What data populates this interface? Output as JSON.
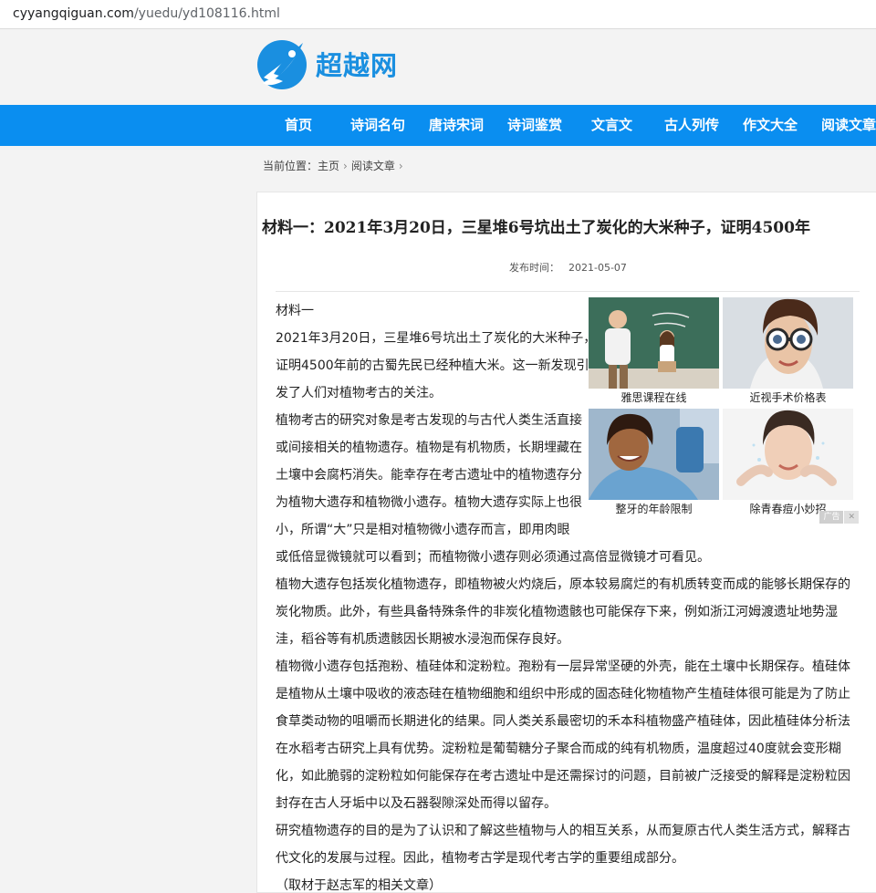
{
  "browser": {
    "url_host": "cyyangqiguan.com",
    "url_path": "/yuedu/yd108116.html"
  },
  "site": {
    "logo_text": "超越网",
    "brand_color": "#1a8fe0",
    "nav_color": "#0a8ef0"
  },
  "nav": {
    "items": [
      "首页",
      "诗词名句",
      "唐诗宋词",
      "诗词鉴赏",
      "文言文",
      "古人列传",
      "作文大全",
      "阅读文章"
    ]
  },
  "breadcrumb": {
    "label": "当前位置：",
    "home": "主页",
    "section": "阅读文章",
    "sep": "›"
  },
  "article": {
    "title": "材料一：2021年3月20日，三星堆6号坑出土了炭化的大米种子，证明4500年",
    "pub_label": "发布时间：",
    "pub_date": "2021-05-07",
    "heading": "材料一",
    "p1_lines": [
      "2021年3月20日，三星堆6号坑出土了炭化的大米种子，",
      "证明4500年前的古蜀先民已经种植大米。这一新发现引",
      "发了人们对植物考古的关注。"
    ],
    "p2_lines": [
      "植物考古的研究对象是考古发现的与古代人类生活直接",
      "或间接相关的植物遗存。植物是有机物质，长期埋藏在",
      "土壤中会腐朽消失。能幸存在考古遗址中的植物遗存分",
      "为植物大遗存和植物微小遗存。植物大遗存实际上也很",
      "小，所谓“大”只是相对植物微小遗存而言，即用肉眼",
      "或低倍显微镜就可以看到；而植物微小遗存则必须通过高倍显微镜才可看见。"
    ],
    "p3_lines": [
      "植物大遗存包括炭化植物遗存，即植物被火灼烧后，原本较易腐烂的有机质转变而成的能够长期保存的",
      "炭化物质。此外，有些具备特殊条件的非炭化植物遗骸也可能保存下来，例如浙江河姆渡遗址地势湿",
      "洼，稻谷等有机质遗骸因长期被水浸泡而保存良好。"
    ],
    "p4_lines": [
      "植物微小遗存包括孢粉、植硅体和淀粉粒。孢粉有一层异常坚硬的外壳，能在土壤中长期保存。植硅体",
      "是植物从土壤中吸收的液态硅在植物细胞和组织中形成的固态硅化物植物产生植硅体很可能是为了防止",
      "食草类动物的咀嚼而长期进化的结果。同人类关系最密切的禾本科植物盛产植硅体，因此植硅体分析法",
      "在水稻考古研究上具有优势。淀粉粒是葡萄糖分子聚合而成的纯有机物质，温度超过40度就会变形糊",
      "化，如此脆弱的淀粉粒如何能保存在考古遗址中是还需探讨的问题，目前被广泛接受的解释是淀粉粒因",
      "封存在古人牙垢中以及石器裂隙深处而得以留存。"
    ],
    "p5_lines": [
      "研究植物遗存的目的是为了认识和了解这些植物与人的相互关系，从而复原古代人类生活方式，解释古",
      "代文化的发展与过程。因此，植物考古学是现代考古学的重要组成部分。"
    ],
    "source": "（取材于赵志军的相关文章）"
  },
  "ads": {
    "items": [
      {
        "caption": "雅思课程在线",
        "icon": "teacher-classroom-photo"
      },
      {
        "caption": "近视手术价格表",
        "icon": "eye-test-glasses-photo"
      },
      {
        "caption": "整牙的年龄限制",
        "icon": "dental-patient-photo"
      },
      {
        "caption": "除青春痘小妙招",
        "icon": "face-washing-photo"
      }
    ],
    "mark_label": "广告",
    "close_label": "✕"
  }
}
